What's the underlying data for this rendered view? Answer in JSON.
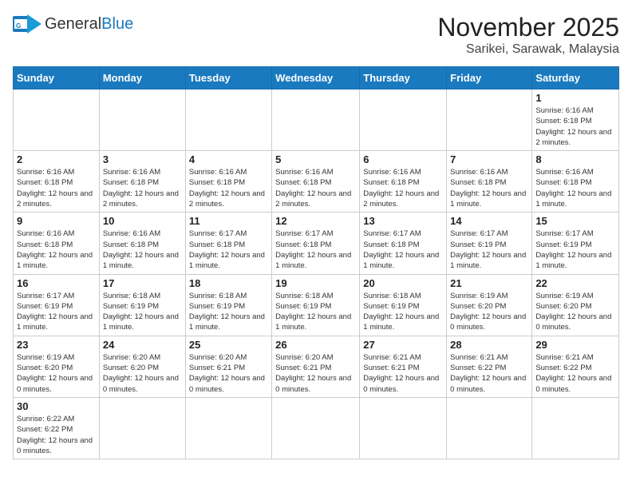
{
  "logo": {
    "general": "General",
    "blue": "Blue"
  },
  "header": {
    "month_year": "November 2025",
    "location": "Sarikei, Sarawak, Malaysia"
  },
  "weekdays": [
    "Sunday",
    "Monday",
    "Tuesday",
    "Wednesday",
    "Thursday",
    "Friday",
    "Saturday"
  ],
  "weeks": [
    [
      {
        "day": "",
        "info": ""
      },
      {
        "day": "",
        "info": ""
      },
      {
        "day": "",
        "info": ""
      },
      {
        "day": "",
        "info": ""
      },
      {
        "day": "",
        "info": ""
      },
      {
        "day": "",
        "info": ""
      },
      {
        "day": "1",
        "info": "Sunrise: 6:16 AM\nSunset: 6:18 PM\nDaylight: 12 hours\nand 2 minutes."
      }
    ],
    [
      {
        "day": "2",
        "info": "Sunrise: 6:16 AM\nSunset: 6:18 PM\nDaylight: 12 hours\nand 2 minutes."
      },
      {
        "day": "3",
        "info": "Sunrise: 6:16 AM\nSunset: 6:18 PM\nDaylight: 12 hours\nand 2 minutes."
      },
      {
        "day": "4",
        "info": "Sunrise: 6:16 AM\nSunset: 6:18 PM\nDaylight: 12 hours\nand 2 minutes."
      },
      {
        "day": "5",
        "info": "Sunrise: 6:16 AM\nSunset: 6:18 PM\nDaylight: 12 hours\nand 2 minutes."
      },
      {
        "day": "6",
        "info": "Sunrise: 6:16 AM\nSunset: 6:18 PM\nDaylight: 12 hours\nand 2 minutes."
      },
      {
        "day": "7",
        "info": "Sunrise: 6:16 AM\nSunset: 6:18 PM\nDaylight: 12 hours\nand 1 minute."
      },
      {
        "day": "8",
        "info": "Sunrise: 6:16 AM\nSunset: 6:18 PM\nDaylight: 12 hours\nand 1 minute."
      }
    ],
    [
      {
        "day": "9",
        "info": "Sunrise: 6:16 AM\nSunset: 6:18 PM\nDaylight: 12 hours\nand 1 minute."
      },
      {
        "day": "10",
        "info": "Sunrise: 6:16 AM\nSunset: 6:18 PM\nDaylight: 12 hours\nand 1 minute."
      },
      {
        "day": "11",
        "info": "Sunrise: 6:17 AM\nSunset: 6:18 PM\nDaylight: 12 hours\nand 1 minute."
      },
      {
        "day": "12",
        "info": "Sunrise: 6:17 AM\nSunset: 6:18 PM\nDaylight: 12 hours\nand 1 minute."
      },
      {
        "day": "13",
        "info": "Sunrise: 6:17 AM\nSunset: 6:18 PM\nDaylight: 12 hours\nand 1 minute."
      },
      {
        "day": "14",
        "info": "Sunrise: 6:17 AM\nSunset: 6:19 PM\nDaylight: 12 hours\nand 1 minute."
      },
      {
        "day": "15",
        "info": "Sunrise: 6:17 AM\nSunset: 6:19 PM\nDaylight: 12 hours\nand 1 minute."
      }
    ],
    [
      {
        "day": "16",
        "info": "Sunrise: 6:17 AM\nSunset: 6:19 PM\nDaylight: 12 hours\nand 1 minute."
      },
      {
        "day": "17",
        "info": "Sunrise: 6:18 AM\nSunset: 6:19 PM\nDaylight: 12 hours\nand 1 minute."
      },
      {
        "day": "18",
        "info": "Sunrise: 6:18 AM\nSunset: 6:19 PM\nDaylight: 12 hours\nand 1 minute."
      },
      {
        "day": "19",
        "info": "Sunrise: 6:18 AM\nSunset: 6:19 PM\nDaylight: 12 hours\nand 1 minute."
      },
      {
        "day": "20",
        "info": "Sunrise: 6:18 AM\nSunset: 6:19 PM\nDaylight: 12 hours\nand 1 minute."
      },
      {
        "day": "21",
        "info": "Sunrise: 6:19 AM\nSunset: 6:20 PM\nDaylight: 12 hours\nand 0 minutes."
      },
      {
        "day": "22",
        "info": "Sunrise: 6:19 AM\nSunset: 6:20 PM\nDaylight: 12 hours\nand 0 minutes."
      }
    ],
    [
      {
        "day": "23",
        "info": "Sunrise: 6:19 AM\nSunset: 6:20 PM\nDaylight: 12 hours\nand 0 minutes."
      },
      {
        "day": "24",
        "info": "Sunrise: 6:20 AM\nSunset: 6:20 PM\nDaylight: 12 hours\nand 0 minutes."
      },
      {
        "day": "25",
        "info": "Sunrise: 6:20 AM\nSunset: 6:21 PM\nDaylight: 12 hours\nand 0 minutes."
      },
      {
        "day": "26",
        "info": "Sunrise: 6:20 AM\nSunset: 6:21 PM\nDaylight: 12 hours\nand 0 minutes."
      },
      {
        "day": "27",
        "info": "Sunrise: 6:21 AM\nSunset: 6:21 PM\nDaylight: 12 hours\nand 0 minutes."
      },
      {
        "day": "28",
        "info": "Sunrise: 6:21 AM\nSunset: 6:22 PM\nDaylight: 12 hours\nand 0 minutes."
      },
      {
        "day": "29",
        "info": "Sunrise: 6:21 AM\nSunset: 6:22 PM\nDaylight: 12 hours\nand 0 minutes."
      }
    ],
    [
      {
        "day": "30",
        "info": "Sunrise: 6:22 AM\nSunset: 6:22 PM\nDaylight: 12 hours\nand 0 minutes."
      },
      {
        "day": "",
        "info": ""
      },
      {
        "day": "",
        "info": ""
      },
      {
        "day": "",
        "info": ""
      },
      {
        "day": "",
        "info": ""
      },
      {
        "day": "",
        "info": ""
      },
      {
        "day": "",
        "info": ""
      }
    ]
  ]
}
